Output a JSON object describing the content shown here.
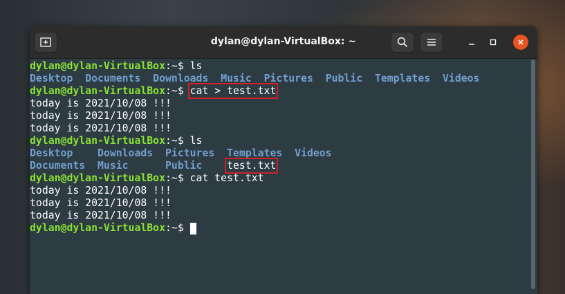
{
  "window": {
    "title": "dylan@dylan-VirtualBox: ~"
  },
  "icons": {
    "new_tab": "new-tab-icon",
    "search": "search-icon",
    "menu": "hamburger-menu-icon",
    "minimize": "minimize-icon",
    "maximize": "maximize-icon",
    "close": "close-icon"
  },
  "colors": {
    "prompt": "#8ae234",
    "directory": "#729fcf",
    "highlight_box": "#d0202a",
    "terminal_bg": "#2d3b42",
    "close_button": "#e95420"
  },
  "terminal": {
    "prompt_user": "dylan@dylan-VirtualBox",
    "prompt_path": ":~$ ",
    "line1_cmd": "ls",
    "ls1": [
      "Desktop",
      "Documents",
      "Downloads",
      "Music",
      "Pictures",
      "Public",
      "Templates",
      "Videos"
    ],
    "line3_cmd": "cat > test.txt",
    "out1": [
      "today is 2021/10/08 !!!",
      "today is 2021/10/08 !!!",
      "today is 2021/10/08 !!!"
    ],
    "line7_cmd": "ls",
    "ls2_row1": [
      "Desktop",
      "Downloads",
      "Pictures",
      "Templates",
      "Videos"
    ],
    "ls2_row2": [
      "Documents",
      "Music",
      "Public"
    ],
    "ls2_file": "test.txt",
    "line10_cmd": "cat test.txt",
    "out2": [
      "today is 2021/10/08 !!!",
      "today is 2021/10/08 !!!",
      "today is 2021/10/08 !!!"
    ]
  }
}
